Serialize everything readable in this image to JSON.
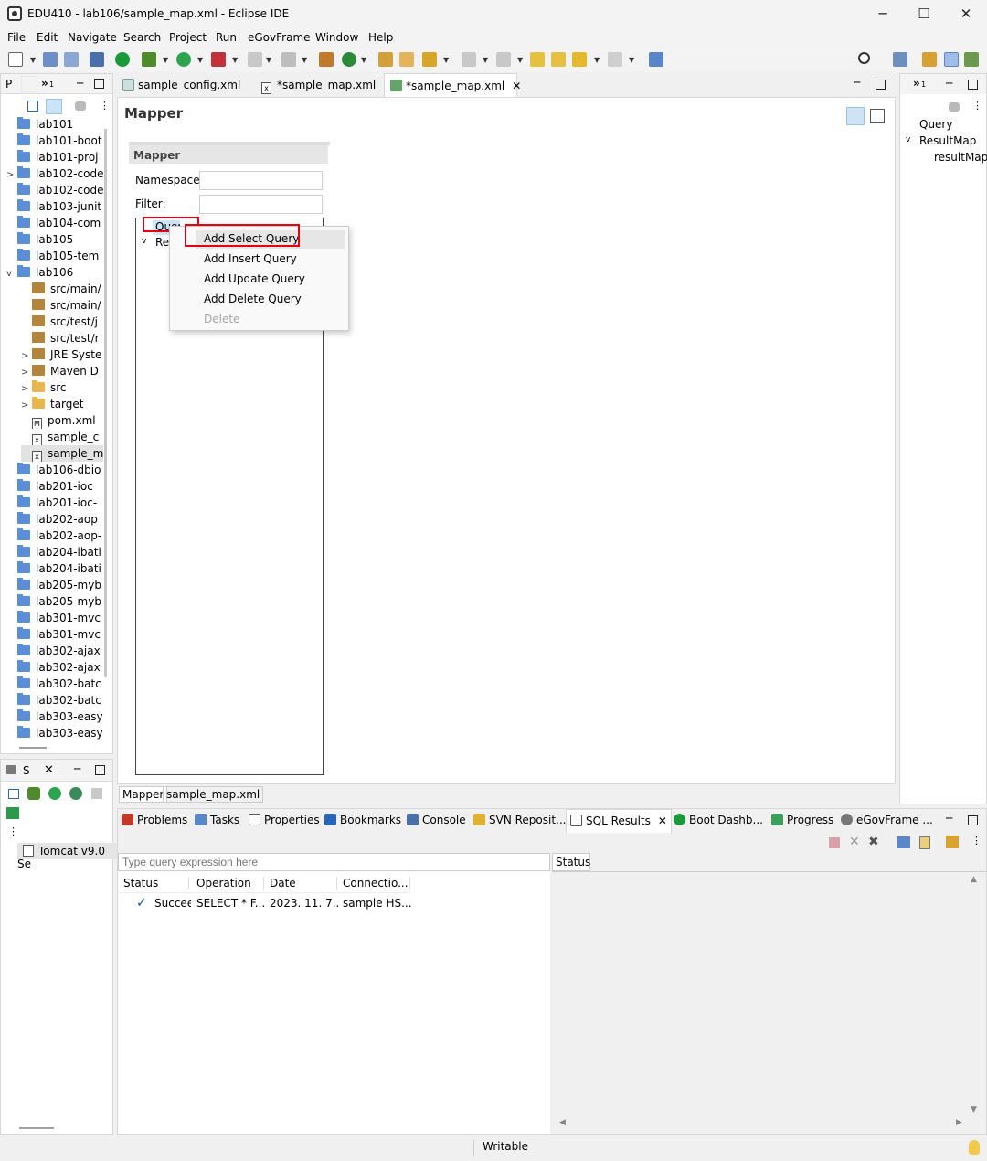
{
  "window": {
    "title": "EDU410 - lab106/sample_map.xml - Eclipse IDE",
    "minimize": "─",
    "maximize": "☐",
    "close": "✕"
  },
  "menu": [
    "File",
    "Edit",
    "Navigate",
    "Search",
    "Project",
    "Run",
    "eGovFrame",
    "Window",
    "Help"
  ],
  "project_explorer": {
    "tab_label": "P",
    "collapse_glyph": "»",
    "collapse_count": "1",
    "items": [
      {
        "label": "lab101",
        "indent": 0,
        "icon": "folder",
        "chev": ""
      },
      {
        "label": "lab101-boot",
        "indent": 0,
        "icon": "folder",
        "chev": ""
      },
      {
        "label": "lab101-proj",
        "indent": 0,
        "icon": "folder",
        "chev": ""
      },
      {
        "label": "lab102-code",
        "indent": 0,
        "icon": "maven-project",
        "chev": ">"
      },
      {
        "label": "lab102-code",
        "indent": 0,
        "icon": "folder",
        "chev": ""
      },
      {
        "label": "lab103-junit",
        "indent": 0,
        "icon": "folder",
        "chev": ""
      },
      {
        "label": "lab104-com",
        "indent": 0,
        "icon": "folder",
        "chev": ""
      },
      {
        "label": "lab105",
        "indent": 0,
        "icon": "folder",
        "chev": ""
      },
      {
        "label": "lab105-tem",
        "indent": 0,
        "icon": "folder",
        "chev": ""
      },
      {
        "label": "lab106",
        "indent": 0,
        "icon": "maven-project",
        "chev": "v"
      },
      {
        "label": "src/main/",
        "indent": 1,
        "icon": "package-folder",
        "chev": ""
      },
      {
        "label": "src/main/",
        "indent": 1,
        "icon": "package-folder",
        "chev": ""
      },
      {
        "label": "src/test/j",
        "indent": 1,
        "icon": "package-folder",
        "chev": ""
      },
      {
        "label": "src/test/r",
        "indent": 1,
        "icon": "package-folder",
        "chev": ""
      },
      {
        "label": "JRE Syste",
        "indent": 1,
        "icon": "library",
        "chev": ">"
      },
      {
        "label": "Maven D",
        "indent": 1,
        "icon": "library",
        "chev": ">"
      },
      {
        "label": "src",
        "indent": 1,
        "icon": "open-folder",
        "chev": ">"
      },
      {
        "label": "target",
        "indent": 1,
        "icon": "open-folder",
        "chev": ">"
      },
      {
        "label": "pom.xml",
        "indent": 1,
        "icon": "maven-file",
        "chev": ""
      },
      {
        "label": "sample_c",
        "indent": 1,
        "icon": "xml-file",
        "chev": ""
      },
      {
        "label": "sample_m",
        "indent": 1,
        "icon": "xml-file",
        "chev": "",
        "selected": true
      },
      {
        "label": "lab106-dbio",
        "indent": 0,
        "icon": "folder",
        "chev": ""
      },
      {
        "label": "lab201-ioc",
        "indent": 0,
        "icon": "folder",
        "chev": ""
      },
      {
        "label": "lab201-ioc-",
        "indent": 0,
        "icon": "folder",
        "chev": ""
      },
      {
        "label": "lab202-aop",
        "indent": 0,
        "icon": "folder",
        "chev": ""
      },
      {
        "label": "lab202-aop-",
        "indent": 0,
        "icon": "folder",
        "chev": ""
      },
      {
        "label": "lab204-ibati",
        "indent": 0,
        "icon": "folder",
        "chev": ""
      },
      {
        "label": "lab204-ibati",
        "indent": 0,
        "icon": "folder",
        "chev": ""
      },
      {
        "label": "lab205-myb",
        "indent": 0,
        "icon": "folder",
        "chev": ""
      },
      {
        "label": "lab205-myb",
        "indent": 0,
        "icon": "folder",
        "chev": ""
      },
      {
        "label": "lab301-mvc",
        "indent": 0,
        "icon": "folder",
        "chev": ""
      },
      {
        "label": "lab301-mvc",
        "indent": 0,
        "icon": "folder",
        "chev": ""
      },
      {
        "label": "lab302-ajax",
        "indent": 0,
        "icon": "folder",
        "chev": ""
      },
      {
        "label": "lab302-ajax",
        "indent": 0,
        "icon": "folder",
        "chev": ""
      },
      {
        "label": "lab302-batc",
        "indent": 0,
        "icon": "folder",
        "chev": ""
      },
      {
        "label": "lab302-batc",
        "indent": 0,
        "icon": "folder",
        "chev": ""
      },
      {
        "label": "lab303-easy",
        "indent": 0,
        "icon": "folder",
        "chev": ""
      },
      {
        "label": "lab303-easy",
        "indent": 0,
        "icon": "folder",
        "chev": ""
      }
    ]
  },
  "servers": {
    "tab_label": "S",
    "item": "Tomcat v9.0 Se"
  },
  "editor": {
    "tabs": [
      {
        "label": "sample_config.xml",
        "active": false
      },
      {
        "label": "*sample_map.xml",
        "active": false
      },
      {
        "label": "*sample_map.xml",
        "active": true,
        "close": "✕"
      }
    ],
    "heading": "Mapper",
    "section_title": "Mapper",
    "namespace_label": "Namespace:",
    "namespace_value": "",
    "filter_label": "Filter:",
    "filter_value": "",
    "tree": [
      {
        "label": "Query",
        "chev": ""
      },
      {
        "label": "Res",
        "chev": "v"
      }
    ],
    "bottom_tabs": [
      "Mapper",
      "sample_map.xml"
    ]
  },
  "context_menu": {
    "items": [
      {
        "label": "Add Select Query",
        "enabled": true,
        "hover": true
      },
      {
        "label": "Add Insert Query",
        "enabled": true
      },
      {
        "label": "Add Update Query",
        "enabled": true
      },
      {
        "label": "Add Delete Query",
        "enabled": true
      },
      {
        "label": "Delete",
        "enabled": false
      }
    ]
  },
  "outline": {
    "collapse_glyph": "»",
    "collapse_count": "1",
    "items": [
      {
        "label": "Query",
        "chev": ""
      },
      {
        "label": "ResultMap",
        "chev": "v"
      },
      {
        "label": "resultMap",
        "chev": ""
      }
    ]
  },
  "bottom_panel": {
    "tabs": [
      "Problems",
      "Tasks",
      "Properties",
      "Bookmarks",
      "Console",
      "SVN Reposit...",
      "SQL Results",
      "Boot Dashb...",
      "Progress",
      "eGovFrame ..."
    ],
    "active_tab": "SQL Results",
    "close_glyph": "✕",
    "query_placeholder": "Type query expression here",
    "columns": [
      "Status",
      "Operation",
      "Date",
      "Connectio..."
    ],
    "rows": [
      {
        "check": "✓",
        "status": "Succeed",
        "operation": "SELECT * F...",
        "date": "2023. 11. 7...",
        "connection": "sample HS..."
      }
    ],
    "status_header": "Status"
  },
  "statusbar": {
    "mode": "Writable"
  },
  "colors": {
    "highlight": "#e8000f",
    "selection": "#cce4f7"
  }
}
